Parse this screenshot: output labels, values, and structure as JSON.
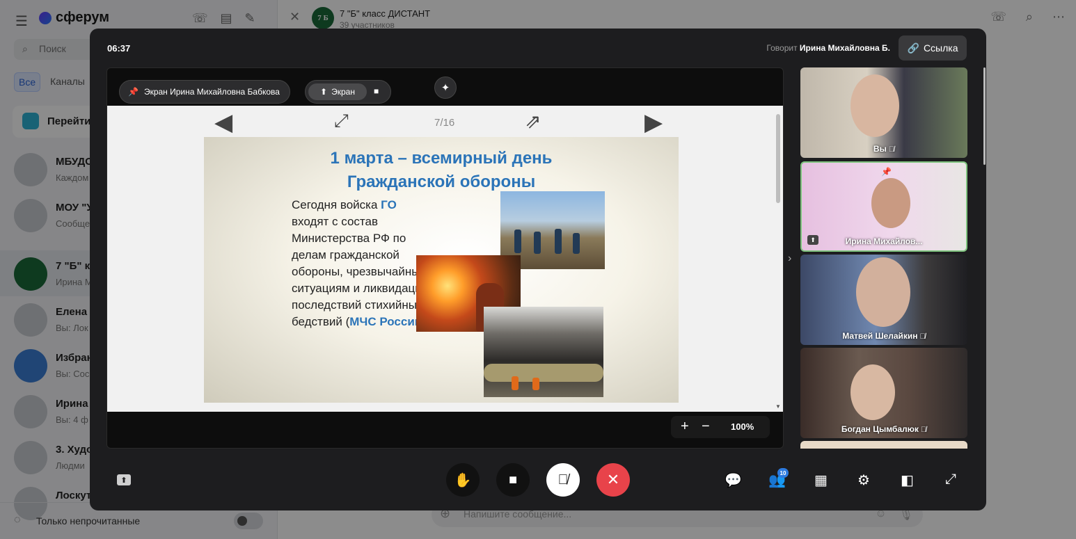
{
  "sidebar": {
    "logo": "сферум",
    "search_placeholder": "Поиск",
    "tabs": [
      {
        "label": "Все",
        "active": true
      },
      {
        "label": "Каналы",
        "active": false
      }
    ],
    "go_label": "Перейти",
    "chats": [
      {
        "name": "МБУДО",
        "sub": "Каждом"
      },
      {
        "name": "МОУ \"У",
        "sub": "Сообще"
      },
      {
        "name": "7 \"Б\" кл",
        "sub": "Ирина М"
      },
      {
        "name": "Елена К",
        "sub": "Вы: Лок"
      },
      {
        "name": "Избран",
        "sub": "Вы: Сос"
      },
      {
        "name": "Ирина",
        "sub": "Вы: 4 ф"
      },
      {
        "name": "3. Худо",
        "sub": "Людми"
      },
      {
        "name": "Лоскут",
        "sub": ""
      }
    ],
    "unread_only": "Только непрочитанные"
  },
  "chat_header": {
    "avatar_text": "7 Б",
    "title": "7 \"Б\" класс ДИСТАНТ",
    "subtitle": "39 участников"
  },
  "composer": {
    "placeholder": "Напишите сообщение..."
  },
  "call": {
    "timer": "06:37",
    "speaking_label": "Говорит",
    "speaker": "Ирина Михайловна Б.",
    "link_button": "Ссылка",
    "screen_pill": "Экран Ирина Михайловна Бабкова",
    "screen_tab": "Экран",
    "viewer": {
      "page": "7/16",
      "zoom": "100%"
    },
    "slide": {
      "title_line1": "1 марта – всемирный день",
      "title_line2": "Гражданской обороны",
      "text_part1": "Сегодня войска ",
      "text_highlight1": "ГО",
      "text_part2": " входят с состав Министерства РФ по делам гражданской обороны, чрезвычайным ситуациям и ликвидации последствий стихийных бедствий (",
      "text_highlight2": "МЧС России",
      "text_part3": ")."
    },
    "participants": [
      {
        "name": "Вы",
        "muted": true
      },
      {
        "name": "Ирина Михайлов...",
        "muted": false,
        "pinned": true,
        "sharing": true
      },
      {
        "name": "Матвей Шелайкин",
        "muted": true
      },
      {
        "name": "Богдан Цымбалюк",
        "muted": true
      }
    ],
    "participants_badge": "10",
    "colors": {
      "end_call": "#e8434a",
      "active_border": "#7fc47f",
      "slide_title": "#2b74b8",
      "badge": "#2d7be0"
    }
  }
}
